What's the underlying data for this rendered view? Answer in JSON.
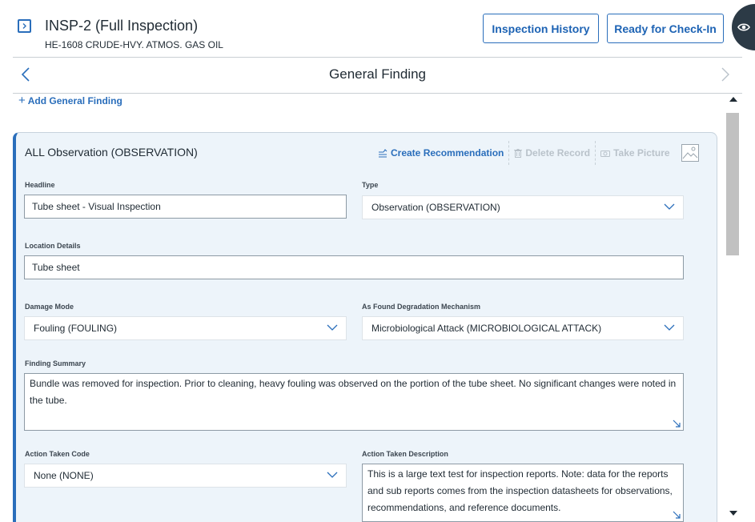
{
  "header": {
    "title": "INSP-2 (Full Inspection)",
    "subtitle": "HE-1608 CRUDE-HVY. ATMOS. GAS OIL",
    "history_button": "Inspection History",
    "checkin_button": "Ready for Check-In"
  },
  "section_nav": {
    "title": "General Finding"
  },
  "add_link": "Add General Finding",
  "card": {
    "title": "ALL Observation (OBSERVATION)",
    "actions": {
      "create": "Create Recommendation",
      "delete": "Delete Record",
      "picture": "Take Picture"
    },
    "fields": {
      "headline": {
        "label": "Headline",
        "value": "Tube sheet - Visual Inspection"
      },
      "type": {
        "label": "Type",
        "value": "Observation (OBSERVATION)"
      },
      "location": {
        "label": "Location Details",
        "value": "Tube sheet"
      },
      "damage_mode": {
        "label": "Damage Mode",
        "value": "Fouling (FOULING)"
      },
      "degradation": {
        "label": "As Found Degradation Mechanism",
        "value": "Microbiological Attack (MICROBIOLOGICAL ATTACK)"
      },
      "summary": {
        "label": "Finding Summary",
        "value": "Bundle was removed for inspection. Prior to cleaning, heavy fouling was observed on the portion of the tube sheet. No significant changes were noted in the tube."
      },
      "action_code": {
        "label": "Action Taken Code",
        "value": "None (NONE)"
      },
      "action_desc": {
        "label": "Action Taken Description",
        "value": "This is a large text test for inspection reports. Note: data for the reports and sub reports comes from the inspection datasheets for observations, recommendations, and reference documents."
      }
    }
  },
  "colors": {
    "accent": "#2a6ebb",
    "card_bg": "#edf4fa",
    "fab": "#2c3a46"
  },
  "icons": [
    "sidebar-toggle-icon",
    "chevron-left-icon",
    "chevron-right-icon",
    "plus-icon",
    "create-recommendation-icon",
    "trash-icon",
    "camera-icon",
    "image-icon",
    "chevron-down-icon",
    "resize-icon",
    "eye-icon"
  ]
}
